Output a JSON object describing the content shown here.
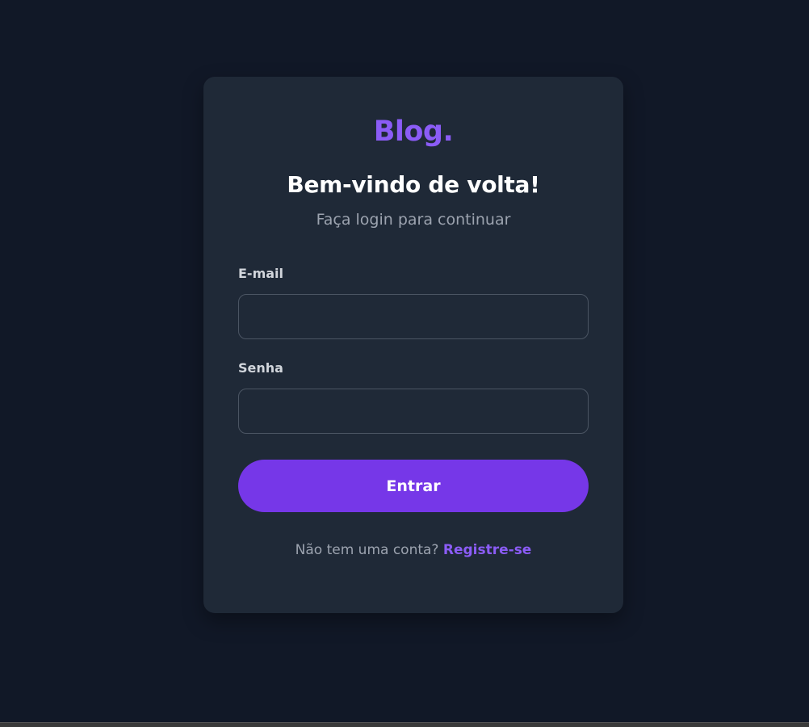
{
  "brand": {
    "logo": "Blog.",
    "accent_color": "#8b5cf6",
    "button_color": "#7637e8"
  },
  "login": {
    "title": "Bem-vindo de volta!",
    "subtitle": "Faça login para continuar",
    "email_label": "E-mail",
    "email_value": "",
    "password_label": "Senha",
    "password_value": "",
    "submit_label": "Entrar",
    "footer_text": "Não tem uma conta?",
    "register_link": "Registre-se"
  },
  "colors": {
    "background": "#111827",
    "card": "#1f2937"
  }
}
